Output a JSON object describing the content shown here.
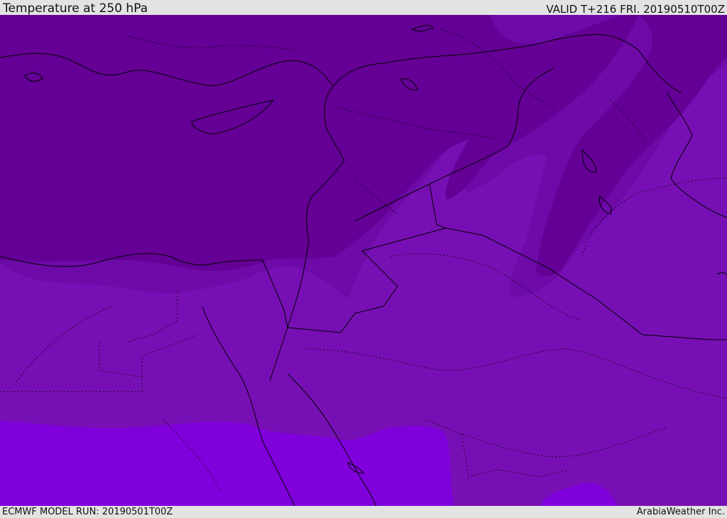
{
  "header": {
    "title": "Temperature at 250 hPa",
    "valid": "VALID T+216 FRI. 20190510T00Z"
  },
  "footer": {
    "model_run": "ECMWF MODEL RUN: 20190501T00Z",
    "credit": "ArabiaWeather Inc."
  },
  "map": {
    "colors": {
      "coldest": "#640096",
      "cold": "#6e0aa8",
      "mid": "#7710b4",
      "warm": "#8000dc",
      "border": "#000000"
    }
  }
}
